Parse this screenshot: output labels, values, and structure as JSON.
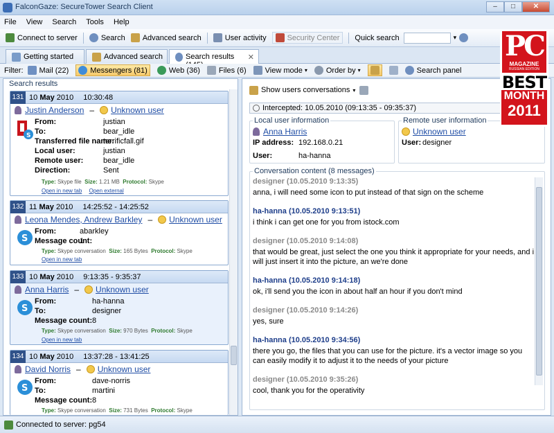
{
  "window": {
    "title": "FalconGaze: SecureTower Search Client"
  },
  "menu": [
    "File",
    "View",
    "Search",
    "Tools",
    "Help"
  ],
  "toolbar": {
    "connect": "Connect to server",
    "search": "Search",
    "advanced": "Advanced search",
    "user_activity": "User activity",
    "security_center": "Security Center",
    "quick_search_label": "Quick search"
  },
  "tabs": [
    "Getting started",
    "Advanced search",
    "Search results (145)"
  ],
  "filter": {
    "label": "Filter:",
    "items": [
      "Mail (22)",
      "Messengers (81)",
      "Web (36)",
      "Files (6)"
    ],
    "view_mode": "View mode",
    "order_by": "Order by",
    "search_panel": "Search panel"
  },
  "results": {
    "title": "Search results",
    "cards": [
      {
        "num": "131",
        "day": "10",
        "month": "May",
        "year": "2010",
        "time": "10:30:48",
        "local": "Justin Anderson",
        "remote": "Unknown user",
        "fields": [
          {
            "k": "From:",
            "v": "justian"
          },
          {
            "k": "To:",
            "v": "bear_idle"
          },
          {
            "k": "Transferred file name:",
            "v": "terrificfall.gif"
          },
          {
            "k": "Local user:",
            "v": "justian"
          },
          {
            "k": "Remote user:",
            "v": "bear_idle"
          },
          {
            "k": "Direction:",
            "v": "Sent"
          }
        ],
        "meta": {
          "type_label": "Type:",
          "type": "Skype file",
          "size_label": "Size:",
          "size": "1.21 MB",
          "proto_label": "Protocol:",
          "proto": "Skype"
        },
        "links": [
          "Open in new tab",
          "Open external"
        ]
      },
      {
        "num": "132",
        "day": "11",
        "month": "May",
        "year": "2010",
        "time": "14:25:52 - 14:25:52",
        "local": "Leona Mendes, Andrew Barkley",
        "remote": "Unknown user",
        "fields": [
          {
            "k": "From:",
            "v": "abarkley"
          },
          {
            "k": "Message count:",
            "v": "1"
          }
        ],
        "meta": {
          "type_label": "Type:",
          "type": "Skype conversation",
          "size_label": "Size:",
          "size": "165 Bytes",
          "proto_label": "Protocol:",
          "proto": "Skype"
        },
        "links": [
          "Open in new tab"
        ]
      },
      {
        "num": "133",
        "day": "10",
        "month": "May",
        "year": "2010",
        "time": "9:13:35 - 9:35:37",
        "local": "Anna Harris",
        "remote": "Unknown user",
        "fields": [
          {
            "k": "From:",
            "v": "ha-hanna"
          },
          {
            "k": "To:",
            "v": "designer"
          },
          {
            "k": "Message count:",
            "v": "8"
          }
        ],
        "meta": {
          "type_label": "Type:",
          "type": "Skype conversation",
          "size_label": "Size:",
          "size": "970 Bytes",
          "proto_label": "Protocol:",
          "proto": "Skype"
        },
        "links": [
          "Open in new tab"
        ]
      },
      {
        "num": "134",
        "day": "10",
        "month": "May",
        "year": "2010",
        "time": "13:37:28 - 13:41:25",
        "local": "David Norris",
        "remote": "Unknown user",
        "fields": [
          {
            "k": "From:",
            "v": "dave-norris"
          },
          {
            "k": "To:",
            "v": "martini"
          },
          {
            "k": "Message count:",
            "v": "8"
          }
        ],
        "meta": {
          "type_label": "Type:",
          "type": "Skype conversation",
          "size_label": "Size:",
          "size": "731 Bytes",
          "proto_label": "Protocol:",
          "proto": "Skype"
        },
        "links": []
      }
    ]
  },
  "detail": {
    "show_conv": "Show users conversations",
    "intercepted": "Intercepted:   10.05.2010 (09:13:35 - 09:35:37)",
    "local_title": "Local user information",
    "local_name": "Anna Harris",
    "ip_label": "IP address:",
    "ip": "192.168.0.21",
    "user_label": "User:",
    "local_user": "ha-hanna",
    "remote_title": "Remote user information",
    "remote_name": "Unknown user",
    "remote_user_label": "User:",
    "remote_user": "designer",
    "conv_title": "Conversation content (8 messages)",
    "messages": [
      {
        "sender": "designer (10.05.2010 9:13:35)",
        "text": "anna, i will need some icon to put instead of that sign on the scheme"
      },
      {
        "sender": "ha-hanna (10.05.2010 9:13:51)",
        "text": "i think i can get one for you from istock.com"
      },
      {
        "sender": "designer (10.05.2010 9:14:08)",
        "text": "that would be great, just select the one you think it appropriate for your needs, and i will just insert it into the picture, an we're done"
      },
      {
        "sender": "ha-hanna (10.05.2010 9:14:18)",
        "text": "ok, i'll send you the icon in about half an hour if you don't mind"
      },
      {
        "sender": "designer (10.05.2010 9:14:26)",
        "text": "yes, sure"
      },
      {
        "sender": "ha-hanna (10.05.2010 9:34:56)",
        "text": "there you go, the files that you can use for the picture. it's a vector image so you can easily modify it to adjust it to the needs of your picture"
      },
      {
        "sender": "designer (10.05.2010 9:35:26)",
        "text": "cool, thank you for the operativity"
      }
    ]
  },
  "status": {
    "text": "Connected to server:  pg54"
  },
  "badge": {
    "pc": "PC",
    "magazine": "MAGAZINE",
    "sub": "RUSSIAN EDITION",
    "best": "BEST",
    "month": "MONTH",
    "year": "2011"
  },
  "colors": {
    "accent": "#2f5189",
    "link": "#1f4da5",
    "badge_red": "#d3141c"
  }
}
